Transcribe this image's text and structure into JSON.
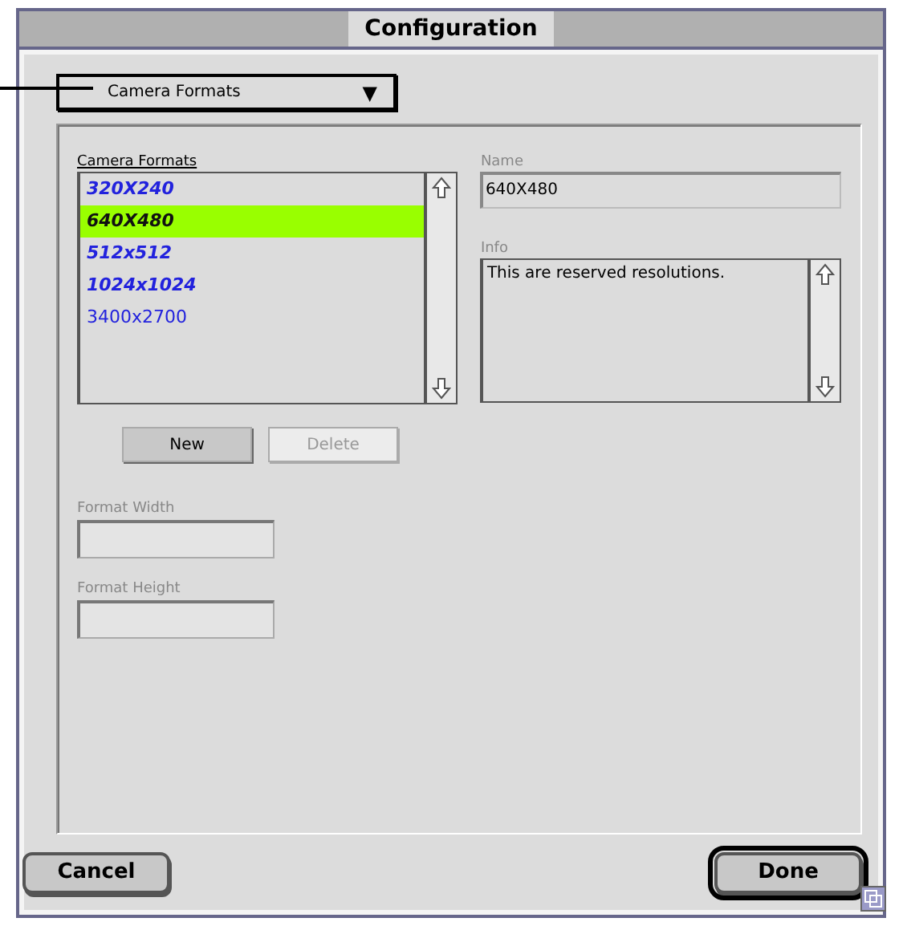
{
  "window": {
    "title": "Configuration"
  },
  "popup": {
    "value": "Camera Formats",
    "arrow": "▼"
  },
  "formats_list": {
    "label": "Camera Formats",
    "items": [
      {
        "text": "320X240",
        "emphasized": true,
        "selected": false
      },
      {
        "text": "640X480",
        "emphasized": true,
        "selected": true
      },
      {
        "text": "512x512",
        "emphasized": true,
        "selected": false
      },
      {
        "text": "1024x1024",
        "emphasized": true,
        "selected": false
      },
      {
        "text": "3400x2700",
        "emphasized": false,
        "selected": false
      }
    ]
  },
  "name_field": {
    "label": "Name",
    "value": "640X480"
  },
  "info_field": {
    "label": "Info",
    "value": "This are reserved resolutions."
  },
  "list_buttons": [
    {
      "label": "New",
      "disabled": false
    },
    {
      "label": "Delete",
      "disabled": true
    }
  ],
  "width_field": {
    "label": "Format Width",
    "disabled": true
  },
  "height_field": {
    "label": "Format Height",
    "disabled": true
  },
  "footer_buttons": [
    {
      "label": "Cancel",
      "default": false
    },
    {
      "label": "Done",
      "default": true
    }
  ]
}
